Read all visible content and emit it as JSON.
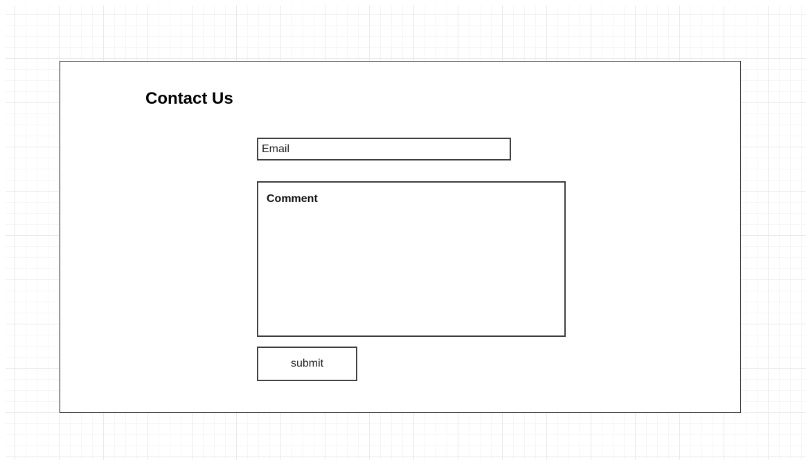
{
  "page": {
    "title": "Contact Us"
  },
  "form": {
    "email": {
      "placeholder": "Email",
      "value": ""
    },
    "comment": {
      "label": "Comment",
      "value": ""
    },
    "submit_label": "submit"
  },
  "colors": {
    "canvas_background": "#ffffff",
    "grid_line": "#e9e9e9",
    "border": "#2b2b2b",
    "text": "#000000"
  }
}
